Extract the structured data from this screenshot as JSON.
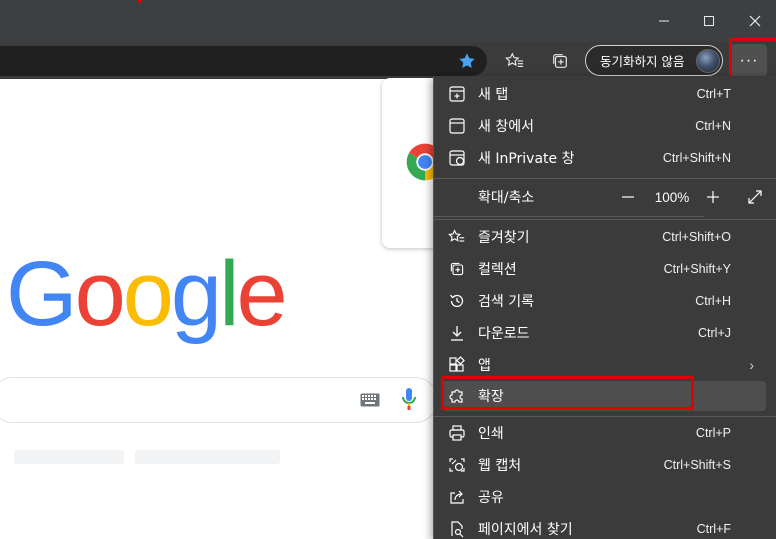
{
  "toolbar": {
    "sync_label": "동기화하지 않음",
    "more_label": "···"
  },
  "window_controls": [
    "minimize",
    "maximize",
    "close"
  ],
  "google": {
    "letters": [
      "G",
      "o",
      "o",
      "g",
      "l",
      "e"
    ],
    "colors": [
      "#4285F4",
      "#EA4335",
      "#FBBC05",
      "#4285F4",
      "#34A853",
      "#EA4335"
    ]
  },
  "menu": {
    "items": [
      {
        "label": "새 탭",
        "shortcut": "Ctrl+T",
        "icon": "new-tab-icon"
      },
      {
        "label": "새 창에서",
        "shortcut": "Ctrl+N",
        "icon": "new-window-icon"
      },
      {
        "label": "새 InPrivate 창",
        "shortcut": "Ctrl+Shift+N",
        "icon": "inprivate-icon"
      },
      {
        "label": "즐겨찾기",
        "shortcut": "Ctrl+Shift+O",
        "icon": "favorites-icon"
      },
      {
        "label": "컬렉션",
        "shortcut": "Ctrl+Shift+Y",
        "icon": "collections-icon"
      },
      {
        "label": "검색 기록",
        "shortcut": "Ctrl+H",
        "icon": "history-icon"
      },
      {
        "label": "다운로드",
        "shortcut": "Ctrl+J",
        "icon": "download-icon"
      },
      {
        "label": "앱",
        "shortcut": "",
        "icon": "apps-icon"
      },
      {
        "label": "확장",
        "shortcut": "",
        "icon": "extensions-icon"
      },
      {
        "label": "인쇄",
        "shortcut": "Ctrl+P",
        "icon": "print-icon"
      },
      {
        "label": "웹 캡처",
        "shortcut": "Ctrl+Shift+S",
        "icon": "web-capture-icon"
      },
      {
        "label": "공유",
        "shortcut": "",
        "icon": "share-icon"
      },
      {
        "label": "페이지에서 찾기",
        "shortcut": "Ctrl+F",
        "icon": "find-icon"
      }
    ],
    "zoom": {
      "label": "확대/축소",
      "value": "100%"
    }
  },
  "colors": {
    "highlight": "#e50000",
    "menu_bg": "#3b3b3b",
    "titlebar_bg": "#3c4043"
  }
}
